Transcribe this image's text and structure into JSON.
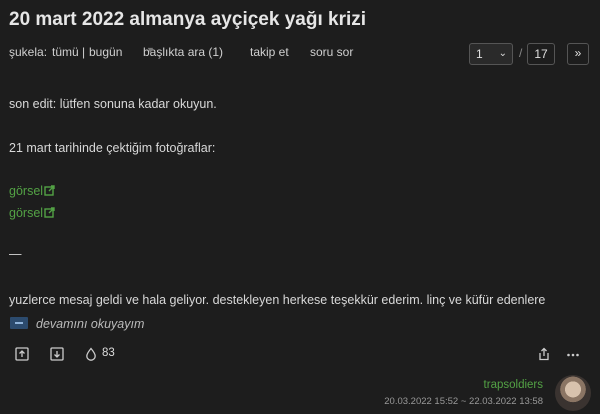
{
  "topic": {
    "title": "20 mart 2022 almanya ayçiçek yağı krizi"
  },
  "subnav": {
    "sukela_label": "şukela:",
    "all_label": "tümü",
    "separator": "|",
    "today_label": "bugün",
    "search_label": "başlıkta ara (1)",
    "follow_label": "takip et",
    "ask_label": "soru sor"
  },
  "pager": {
    "current": "1",
    "divider": "/",
    "total": "17",
    "next": "»"
  },
  "entry": {
    "line1": "son edit: lütfen sonuna kadar okuyun.",
    "line2": "21 mart tarihinde çektiğim fotoğraflar:",
    "link1": "görsel",
    "link2": "görsel",
    "divider": "—",
    "line3": "yuzlerce mesaj geldi ve hala geliyor. destekleyen herkese teşekkür ederim. linç ve küfür edenlere",
    "read_more": "devamını okuyayım"
  },
  "actions": {
    "favorite_count": "83"
  },
  "meta": {
    "author": "trapsoldiers",
    "dates": "20.03.2022 15:52 ~ 22.03.2022 13:58"
  },
  "colors": {
    "background": "#1d1d1d",
    "link": "#53a245",
    "text": "#d6d6d6",
    "muted": "#999999"
  },
  "icons": [
    "chevron-down-icon",
    "external-link-icon",
    "upvote-icon",
    "downvote-icon",
    "drop-icon",
    "share-icon",
    "more-icon"
  ]
}
